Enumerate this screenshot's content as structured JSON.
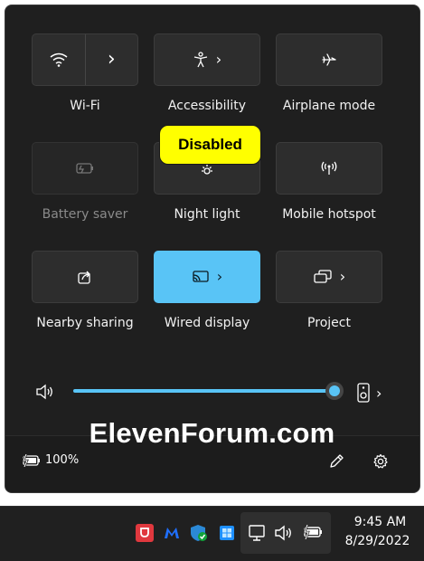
{
  "tiles": [
    {
      "name": "wifi",
      "label": "Wi-Fi",
      "icon": "wifi-icon",
      "chevron": "›",
      "state": "on-split"
    },
    {
      "name": "accessibility",
      "label": "Accessibility",
      "icon": "accessibility-icon",
      "chevron": "›",
      "state": "off"
    },
    {
      "name": "airplane-mode",
      "label": "Airplane mode",
      "icon": "airplane-icon",
      "state": "off"
    },
    {
      "name": "battery-saver",
      "label": "Battery saver",
      "icon": "battery-saver-icon",
      "state": "disabled"
    },
    {
      "name": "night-light",
      "label": "Night light",
      "icon": "night-light-icon",
      "state": "off"
    },
    {
      "name": "mobile-hotspot",
      "label": "Mobile hotspot",
      "icon": "hotspot-icon",
      "state": "off"
    },
    {
      "name": "nearby-sharing",
      "label": "Nearby sharing",
      "icon": "share-icon",
      "state": "off"
    },
    {
      "name": "wired-display",
      "label": "Wired display",
      "icon": "cast-icon",
      "chevron": "›",
      "state": "on"
    },
    {
      "name": "project",
      "label": "Project",
      "icon": "project-icon",
      "chevron": "›",
      "state": "off"
    }
  ],
  "tooltip": {
    "text": "Disabled"
  },
  "volume": {
    "level": 1.0,
    "icon": "speaker-icon",
    "output_icon": "speaker-device-icon",
    "chevron": "›"
  },
  "footer": {
    "battery_percent": "100%",
    "battery_icon": "battery-charging-icon",
    "edit_icon": "pencil-icon",
    "settings_icon": "gear-icon"
  },
  "watermark": "ElevenForum.com",
  "taskbar": {
    "tray_apps": [
      "pocket-icon",
      "malwarebytes-icon",
      "defender-icon",
      "windows-app-icon"
    ],
    "status_icons": [
      "network-icon",
      "volume-icon",
      "battery-icon"
    ],
    "time": "9:45 AM",
    "date": "8/29/2022"
  },
  "colors": {
    "accent": "#59c4f6",
    "panel": "#1f1f1f",
    "tile": "#2d2d2d",
    "tooltip": "#ffff00"
  }
}
